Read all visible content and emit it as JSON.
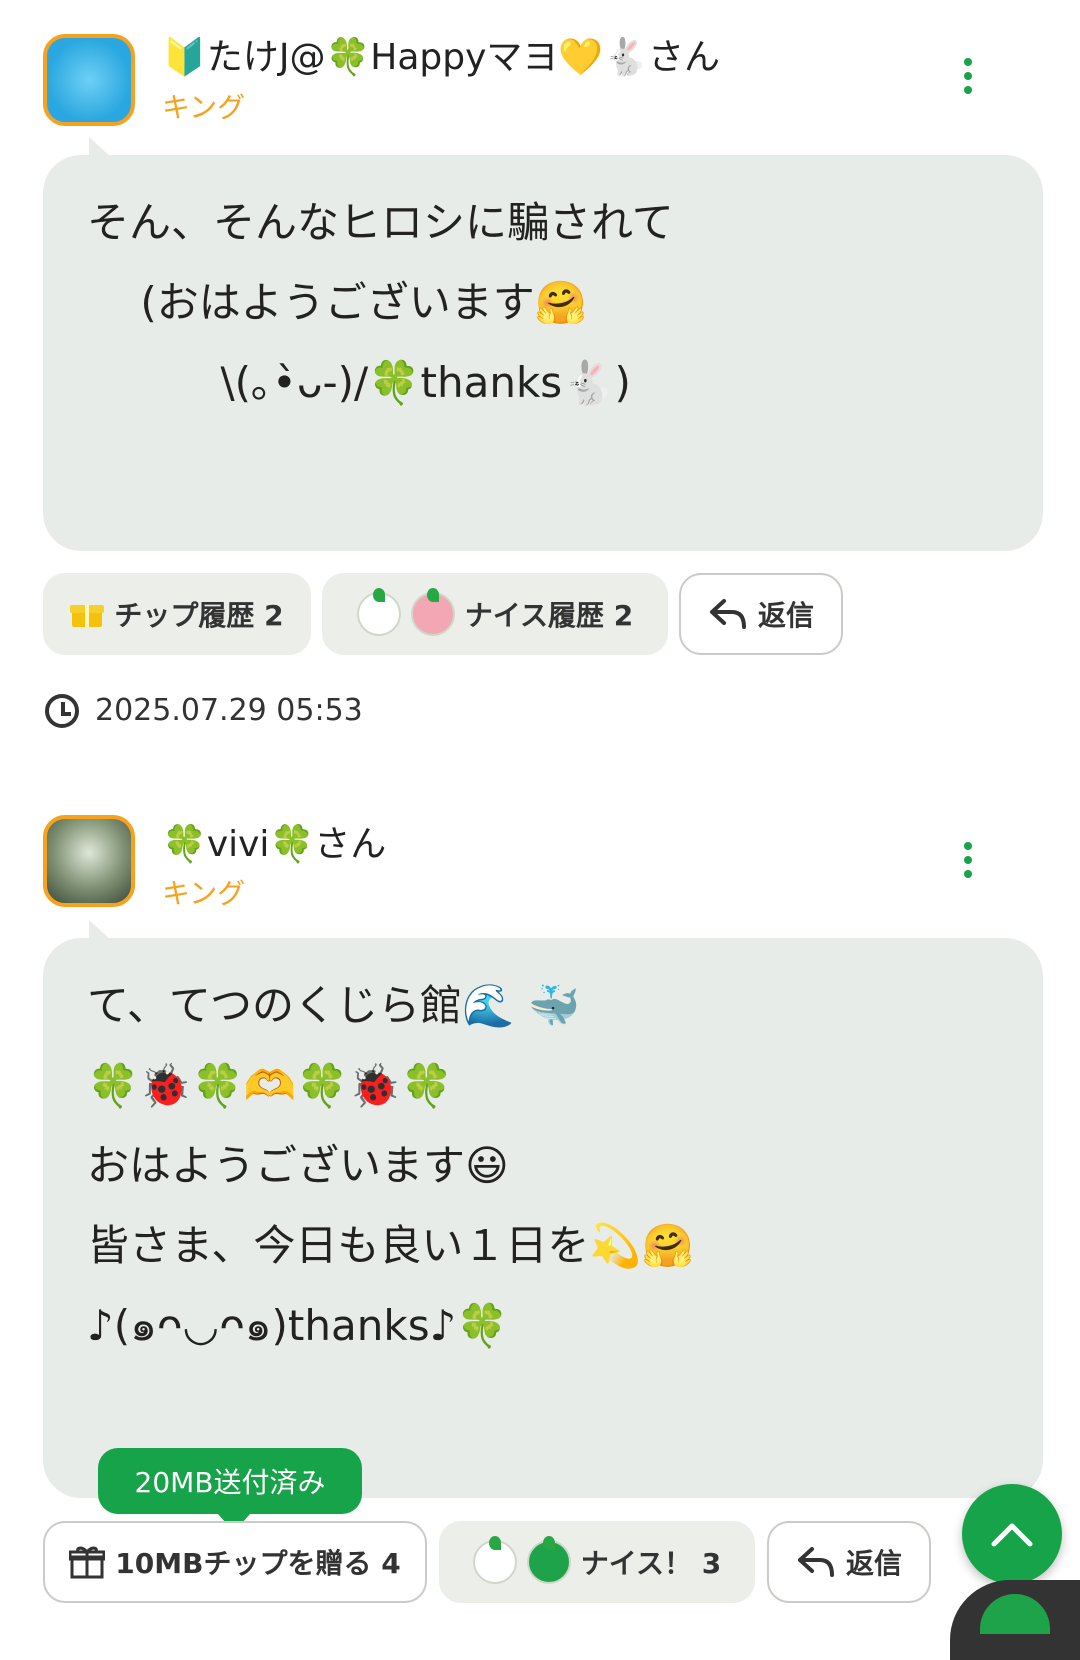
{
  "posts": [
    {
      "username": "🔰たけJ@🍀Happyマヨ💛🐇さん",
      "rank": "キング",
      "lines": [
        "そん、そんなヒロシに騙されて",
        "",
        "    (おはようございます🤗",
        "          \\(｡•̀ᴗ-)/🍀thanks🐇)"
      ],
      "tip_button": "チップ履歴 2",
      "nice_button": "ナイス履歴  2",
      "reply_button": "返信",
      "timestamp": "2025.07.29 05:53"
    },
    {
      "username": "🍀vivi🍀さん",
      "rank": "キング",
      "lines": [
        "て、てつのくじら館🌊 🐳",
        "",
        "🍀🐞🍀🫶🍀🐞🍀",
        "おはようございます😃",
        "皆さま、今日も良い１日を💫🤗",
        "♪(๑ᴖ◡ᴖ๑)thanks♪🍀"
      ],
      "tip_button": "10MBチップを贈る 4",
      "nice_button": "ナイス！ 3",
      "reply_button": "返信",
      "tooltip": "20MB送付済み"
    }
  ],
  "icons": {
    "kebab": "more-vertical-icon",
    "gift": "gift-icon",
    "reply": "reply-arrow-icon",
    "clock": "clock-icon",
    "scroll_top": "chevron-up-icon"
  },
  "colors": {
    "accent_green": "#17a34a",
    "rank_orange": "#f6a21e",
    "bubble_bg": "#e8ece8"
  }
}
